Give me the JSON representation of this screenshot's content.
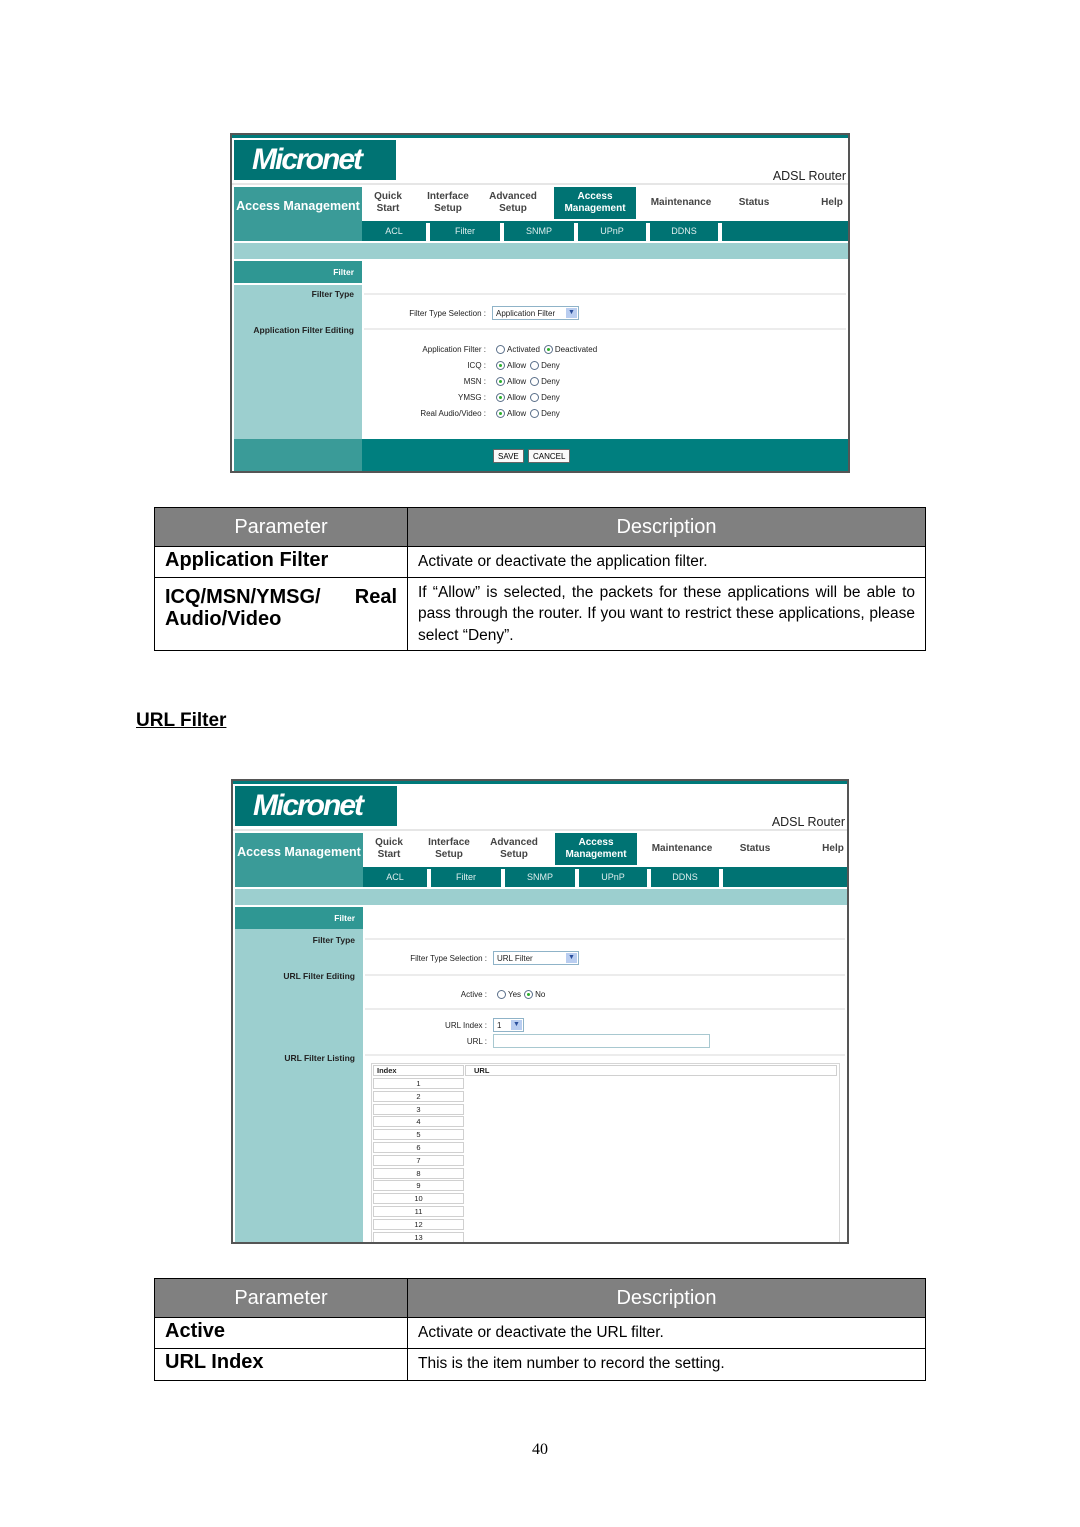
{
  "screenshots": [
    {
      "brand": "Micronet",
      "product": "ADSL Router",
      "section_title": "Access Management",
      "nav_tabs": [
        {
          "label": "Quick Start",
          "active": false
        },
        {
          "label": "Interface Setup",
          "active": false
        },
        {
          "label": "Advanced Setup",
          "active": false
        },
        {
          "label": "Access Management",
          "active": true
        },
        {
          "label": "Maintenance",
          "active": false
        },
        {
          "label": "Status",
          "active": false
        },
        {
          "label": "Help",
          "active": false
        }
      ],
      "sub_tabs": [
        "ACL",
        "Filter",
        "SNMP",
        "UPnP",
        "DDNS"
      ],
      "active_sub_tab": "Filter",
      "left_labels": {
        "header": "Filter",
        "filter_type": "Filter Type",
        "editing": "Application Filter Editing"
      },
      "filter_type_selection_label": "Filter Type Selection :",
      "filter_type_selection_value": "Application Filter",
      "application_filter": {
        "label": "Application Filter :",
        "options": [
          "Activated",
          "Deactivated"
        ],
        "selected": "Deactivated"
      },
      "apps": [
        {
          "label": "ICQ :",
          "options": [
            "Allow",
            "Deny"
          ],
          "selected": "Allow"
        },
        {
          "label": "MSN :",
          "options": [
            "Allow",
            "Deny"
          ],
          "selected": "Allow"
        },
        {
          "label": "YMSG :",
          "options": [
            "Allow",
            "Deny"
          ],
          "selected": "Allow"
        },
        {
          "label": "Real Audio/Video :",
          "options": [
            "Allow",
            "Deny"
          ],
          "selected": "Allow"
        }
      ],
      "buttons": {
        "save": "SAVE",
        "cancel": "CANCEL"
      }
    },
    {
      "brand": "Micronet",
      "product": "ADSL Router",
      "section_title": "Access Management",
      "nav_tabs": [
        {
          "label": "Quick Start",
          "active": false
        },
        {
          "label": "Interface Setup",
          "active": false
        },
        {
          "label": "Advanced Setup",
          "active": false
        },
        {
          "label": "Access Management",
          "active": true
        },
        {
          "label": "Maintenance",
          "active": false
        },
        {
          "label": "Status",
          "active": false
        },
        {
          "label": "Help",
          "active": false
        }
      ],
      "sub_tabs": [
        "ACL",
        "Filter",
        "SNMP",
        "UPnP",
        "DDNS"
      ],
      "active_sub_tab": "Filter",
      "left_labels": {
        "header": "Filter",
        "filter_type": "Filter Type",
        "editing": "URL Filter Editing",
        "listing": "URL Filter Listing"
      },
      "filter_type_selection_label": "Filter Type Selection :",
      "filter_type_selection_value": "URL Filter",
      "active": {
        "label": "Active :",
        "options": [
          "Yes",
          "No"
        ],
        "selected": "No"
      },
      "url_index": {
        "label": "URL Index :",
        "value": "1"
      },
      "url": {
        "label": "URL :",
        "value": ""
      },
      "listing": {
        "columns": [
          "Index",
          "URL"
        ],
        "rows": [
          "1",
          "2",
          "3",
          "4",
          "5",
          "6",
          "7",
          "8",
          "9",
          "10",
          "11",
          "12",
          "13"
        ]
      }
    }
  ],
  "table1": {
    "headers": [
      "Parameter",
      "Description"
    ],
    "rows": [
      {
        "param": "Application Filter",
        "desc": "Activate or deactivate the application filter."
      },
      {
        "param_line1": "ICQ/MSN/YMSG/ Real",
        "param_line2": "Audio/Video",
        "desc": "If “Allow” is selected, the packets for these applications will be able to pass through the router. If you want to restrict these applications, please select “Deny”."
      }
    ]
  },
  "section_heading": "URL Filter",
  "table2": {
    "headers": [
      "Parameter",
      "Description"
    ],
    "rows": [
      {
        "param": "Active",
        "desc": "Activate or deactivate the URL filter."
      },
      {
        "param": "URL Index",
        "desc": "This is the item number to record the setting."
      }
    ]
  },
  "page_number": "40"
}
